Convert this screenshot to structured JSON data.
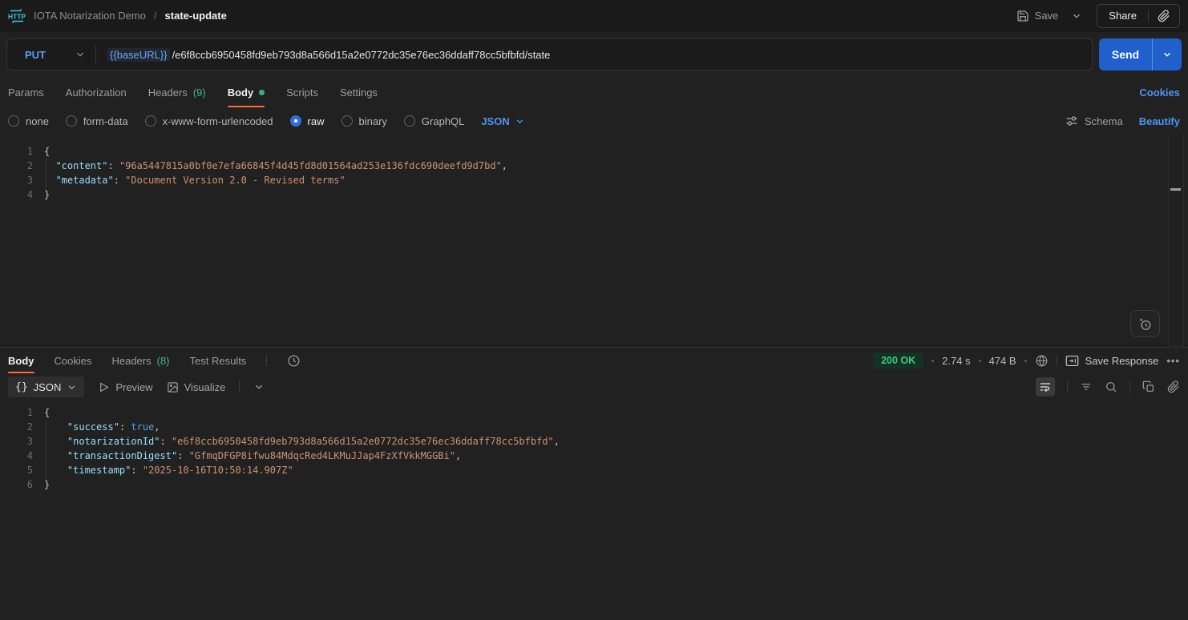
{
  "header": {
    "breadcrumb_collection": "IOTA Notarization Demo",
    "breadcrumb_separator": "/",
    "breadcrumb_item": "state-update",
    "save_label": "Save",
    "share_label": "Share"
  },
  "request": {
    "method": "PUT",
    "url_variable": "{{baseURL}}",
    "url_path": "/e6f8ccb6950458fd9eb793d8a566d15a2e0772dc35e76ec36ddaff78cc5bfbfd/state",
    "send_label": "Send",
    "tabs": [
      {
        "label": "Params",
        "count": ""
      },
      {
        "label": "Authorization",
        "count": ""
      },
      {
        "label": "Headers",
        "count": "(9)"
      },
      {
        "label": "Body",
        "count": ""
      },
      {
        "label": "Scripts",
        "count": ""
      },
      {
        "label": "Settings",
        "count": ""
      }
    ],
    "cookies_link": "Cookies",
    "body_options": {
      "radios": [
        "none",
        "form-data",
        "x-www-form-urlencoded",
        "raw",
        "binary",
        "GraphQL"
      ],
      "selected": "raw",
      "language": "JSON",
      "schema_label": "Schema",
      "beautify_label": "Beautify"
    },
    "body_lines": [
      {
        "n": "1",
        "t": [
          {
            "v": "{",
            "c": "p"
          }
        ]
      },
      {
        "n": "2",
        "t": [
          {
            "v": "  ",
            "c": "p"
          },
          {
            "v": "\"content\"",
            "c": "k"
          },
          {
            "v": ": ",
            "c": "p"
          },
          {
            "v": "\"96a5447815a0bf0e7efa66845f4d45fd8d01564ad253e136fdc690deefd9d7bd\"",
            "c": "s"
          },
          {
            "v": ",",
            "c": "p"
          }
        ]
      },
      {
        "n": "3",
        "t": [
          {
            "v": "  ",
            "c": "p"
          },
          {
            "v": "\"metadata\"",
            "c": "k"
          },
          {
            "v": ": ",
            "c": "p"
          },
          {
            "v": "\"Document Version 2.0 - Revised terms\"",
            "c": "s"
          }
        ]
      },
      {
        "n": "4",
        "t": [
          {
            "v": "}",
            "c": "p"
          }
        ]
      }
    ]
  },
  "response": {
    "tabs": [
      {
        "label": "Body",
        "count": ""
      },
      {
        "label": "Cookies",
        "count": ""
      },
      {
        "label": "Headers",
        "count": "(8)"
      },
      {
        "label": "Test Results",
        "count": ""
      }
    ],
    "status": "200 OK",
    "time": "2.74 s",
    "size": "474 B",
    "save_response_label": "Save Response",
    "overflow_label": "•••",
    "toolbar": {
      "format_icon": "{}",
      "format": "JSON",
      "preview_label": "Preview",
      "visualize_label": "Visualize"
    },
    "body_lines": [
      {
        "n": "1",
        "t": [
          {
            "v": "{",
            "c": "p"
          }
        ]
      },
      {
        "n": "2",
        "t": [
          {
            "v": "    ",
            "c": "p"
          },
          {
            "v": "\"success\"",
            "c": "k"
          },
          {
            "v": ": ",
            "c": "p"
          },
          {
            "v": "true",
            "c": "b"
          },
          {
            "v": ",",
            "c": "p"
          }
        ]
      },
      {
        "n": "3",
        "t": [
          {
            "v": "    ",
            "c": "p"
          },
          {
            "v": "\"notarizationId\"",
            "c": "k"
          },
          {
            "v": ": ",
            "c": "p"
          },
          {
            "v": "\"e6f8ccb6950458fd9eb793d8a566d15a2e0772dc35e76ec36ddaff78cc5bfbfd\"",
            "c": "s"
          },
          {
            "v": ",",
            "c": "p"
          }
        ]
      },
      {
        "n": "4",
        "t": [
          {
            "v": "    ",
            "c": "p"
          },
          {
            "v": "\"transactionDigest\"",
            "c": "k"
          },
          {
            "v": ": ",
            "c": "p"
          },
          {
            "v": "\"GfmqDFGP8ifwu84MdqcRed4LKMuJJap4FzXfVkkMGGBi\"",
            "c": "s"
          },
          {
            "v": ",",
            "c": "p"
          }
        ]
      },
      {
        "n": "5",
        "t": [
          {
            "v": "    ",
            "c": "p"
          },
          {
            "v": "\"timestamp\"",
            "c": "k"
          },
          {
            "v": ": ",
            "c": "p"
          },
          {
            "v": "\"2025-10-16T10:50:14.907Z\"",
            "c": "s"
          }
        ]
      },
      {
        "n": "6",
        "t": [
          {
            "v": "}",
            "c": "p"
          }
        ]
      }
    ]
  },
  "colors": {
    "accent_orange": "#ff6c37",
    "success_green": "#3fb97f",
    "link_blue": "#4e95f2",
    "send_button_blue": "#2160cb",
    "status_badge_bg": "#143223",
    "status_badge_text": "#42c584",
    "http_icon_teal": "#45c6d8"
  }
}
